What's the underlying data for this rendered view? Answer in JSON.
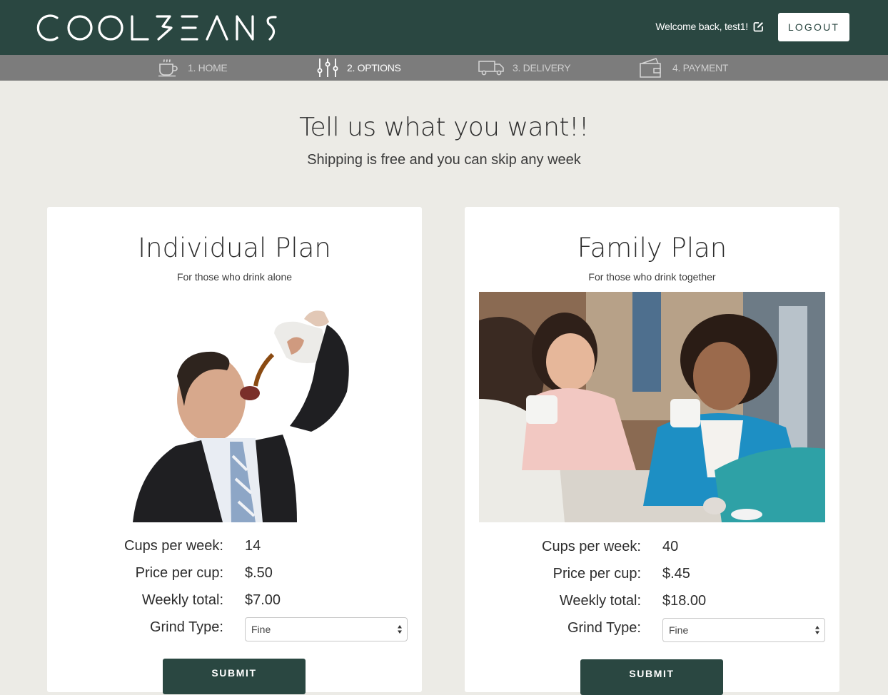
{
  "header": {
    "logo_text": "COOLBEANS",
    "welcome_text": "Welcome back, test1!",
    "logout_label": "LOGOUT"
  },
  "steps": [
    {
      "label": "1. HOME",
      "icon": "coffee-cup-icon",
      "active": false
    },
    {
      "label": "2. OPTIONS",
      "icon": "sliders-icon",
      "active": true
    },
    {
      "label": "3. DELIVERY",
      "icon": "truck-icon",
      "active": false
    },
    {
      "label": "4. PAYMENT",
      "icon": "wallet-icon",
      "active": false
    }
  ],
  "hero": {
    "title": "Tell us what you want!!",
    "subtitle": "Shipping is free and you can skip any week"
  },
  "plans": [
    {
      "title": "Individual Plan",
      "tagline": "For those who drink alone",
      "image": "man-pouring-coffee-into-mouth-photo",
      "cups_label": "Cups per week:",
      "cups_value": "14",
      "price_label": "Price per cup:",
      "price_value": "$.50",
      "total_label": "Weekly total:",
      "total_value": "$7.00",
      "grind_label": "Grind Type:",
      "grind_value": "Fine",
      "submit_label": "SUBMIT"
    },
    {
      "title": "Family Plan",
      "tagline": "For those who drink together",
      "image": "friends-drinking-coffee-photo",
      "cups_label": "Cups per week:",
      "cups_value": "40",
      "price_label": "Price per cup:",
      "price_value": "$.45",
      "total_label": "Weekly total:",
      "total_value": "$18.00",
      "grind_label": "Grind Type:",
      "grind_value": "Fine",
      "submit_label": "SUBMIT"
    }
  ],
  "colors": {
    "header_bg": "#2a4741",
    "steps_bg": "#7c7c7c",
    "page_bg": "#ecebe6",
    "button_bg": "#2a4741"
  }
}
